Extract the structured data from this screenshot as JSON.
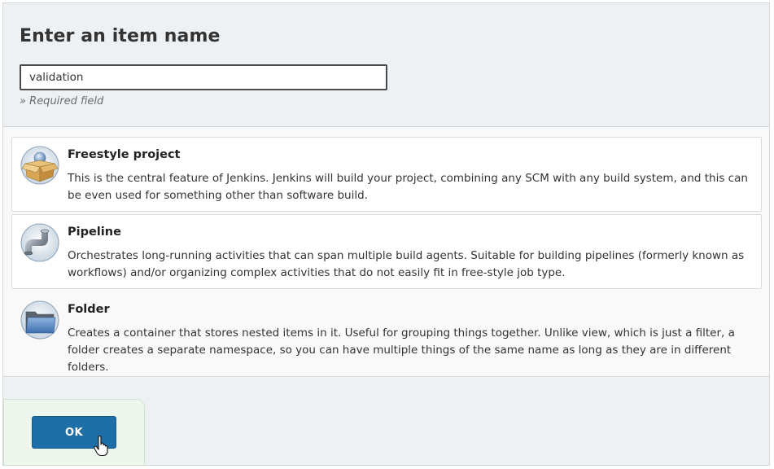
{
  "header": {
    "title": "Enter an item name",
    "name_value": "validation",
    "required_note": "» Required field"
  },
  "items": [
    {
      "label": "Freestyle project",
      "description": "This is the central feature of Jenkins. Jenkins will build your project, combining any SCM with any build system, and this can be even used for something other than software build.",
      "icon": "freestyle-box-icon"
    },
    {
      "label": "Pipeline",
      "description": "Orchestrates long-running activities that can span multiple build agents. Suitable for building pipelines (formerly known as workflows) and/or organizing complex activities that do not easily fit in free-style job type.",
      "icon": "pipeline-pipe-icon"
    },
    {
      "label": "Folder",
      "description": "Creates a container that stores nested items in it. Useful for grouping things together. Unlike view, which is just a filter, a folder creates a separate namespace, so you can have multiple things of the same name as long as they are in different folders.",
      "icon": "folder-icon"
    }
  ],
  "footer": {
    "ok_label": "OK"
  },
  "colors": {
    "ok_button": "#1e6fa8",
    "panel_background": "#eef1f3",
    "footer_background": "#eef7ee"
  }
}
